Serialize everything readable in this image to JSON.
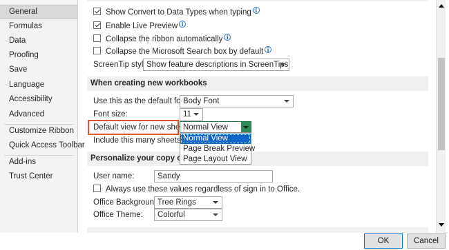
{
  "sidebar": {
    "items": [
      {
        "label": "General",
        "selected": true
      },
      {
        "label": "Formulas"
      },
      {
        "label": "Data"
      },
      {
        "label": "Proofing"
      },
      {
        "label": "Save"
      },
      {
        "label": "Language"
      },
      {
        "label": "Accessibility"
      },
      {
        "label": "Advanced"
      },
      {
        "label": "Customize Ribbon"
      },
      {
        "label": "Quick Access Toolbar"
      },
      {
        "label": "Add-ins"
      },
      {
        "label": "Trust Center"
      }
    ]
  },
  "options": {
    "show_convert_data_types": {
      "label": "Show Convert to Data Types when typing",
      "checked": true
    },
    "enable_live_preview": {
      "label": "Enable Live Preview",
      "checked": true
    },
    "collapse_ribbon": {
      "label": "Collapse the ribbon automatically",
      "checked": false
    },
    "collapse_search": {
      "label": "Collapse the Microsoft Search box by default",
      "checked": false
    },
    "screentip_style": {
      "label": "ScreenTip style:",
      "value": "Show feature descriptions in ScreenTips"
    }
  },
  "new_workbooks": {
    "heading": "When creating new workbooks",
    "default_font": {
      "label": "Use this as the default font:",
      "value": "Body Font"
    },
    "font_size": {
      "label": "Font size:",
      "value": "11"
    },
    "default_view": {
      "label": "Default view for new sheets:",
      "value": "Normal View",
      "options": [
        "Normal View",
        "Page Break Preview",
        "Page Layout View"
      ]
    },
    "sheets_count": {
      "label": "Include this many sheets:"
    }
  },
  "personalize": {
    "heading": "Personalize your copy of Microsoft Office",
    "user_name": {
      "label": "User name:",
      "value": "Sandy"
    },
    "always_use": {
      "label": "Always use these values regardless of sign in to Office.",
      "checked": false
    },
    "office_background": {
      "label": "Office Background:",
      "value": "Tree Rings"
    },
    "office_theme": {
      "label": "Office Theme:",
      "value": "Colorful"
    }
  },
  "footer": {
    "ok_label": "OK",
    "cancel_label": "Cancel"
  },
  "colors": {
    "highlight": "#e0522e",
    "selected_option": "#0f66c7",
    "dropdown_button": "#2e8b57"
  }
}
